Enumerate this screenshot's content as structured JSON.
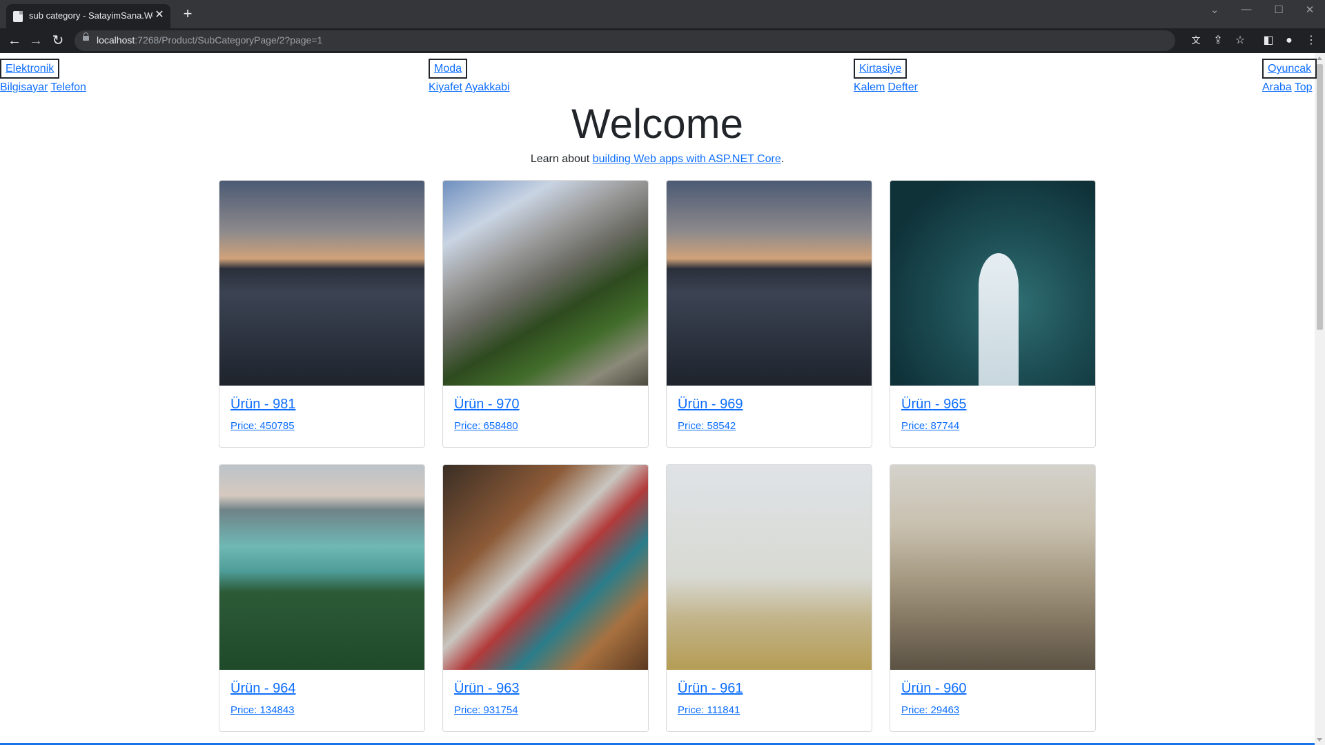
{
  "browser": {
    "tab_title": "sub category - SatayimSana.Web",
    "url_host": "localhost",
    "url_path": ":7268/Product/SubCategoryPage/2?page=1"
  },
  "nav": {
    "categories": [
      {
        "label": "Elektronik",
        "subs": [
          "Bilgisayar",
          "Telefon"
        ]
      },
      {
        "label": "Moda",
        "subs": [
          "Kiyafet",
          "Ayakkabi"
        ]
      },
      {
        "label": "Kirtasiye",
        "subs": [
          "Kalem",
          "Defter"
        ]
      },
      {
        "label": "Oyuncak",
        "subs": [
          "Araba",
          "Top"
        ]
      }
    ]
  },
  "hero": {
    "title": "Welcome",
    "lead_text": "Learn about ",
    "lead_link": "building Web apps with ASP.NET Core",
    "lead_end": "."
  },
  "products": [
    {
      "name": "Ürün - 981",
      "price": "Price: 450785",
      "image": "city-skyline-at-sunset"
    },
    {
      "name": "Ürün - 970",
      "price": "Price: 658480",
      "image": "mountain-forest-river"
    },
    {
      "name": "Ürün - 969",
      "price": "Price: 58542",
      "image": "city-skyline-at-sunset"
    },
    {
      "name": "Ürün - 965",
      "price": "Price: 87744",
      "image": "couple-on-boat-aerial"
    },
    {
      "name": "Ürün - 964",
      "price": "Price: 134843",
      "image": "lake-between-mountains"
    },
    {
      "name": "Ürün - 963",
      "price": "Price: 931754",
      "image": "back-to-school-desk"
    },
    {
      "name": "Ürün - 961",
      "price": "Price: 111841",
      "image": "foggy-field-goal"
    },
    {
      "name": "Ürün - 960",
      "price": "Price: 29463",
      "image": "city-aerial-view"
    }
  ]
}
